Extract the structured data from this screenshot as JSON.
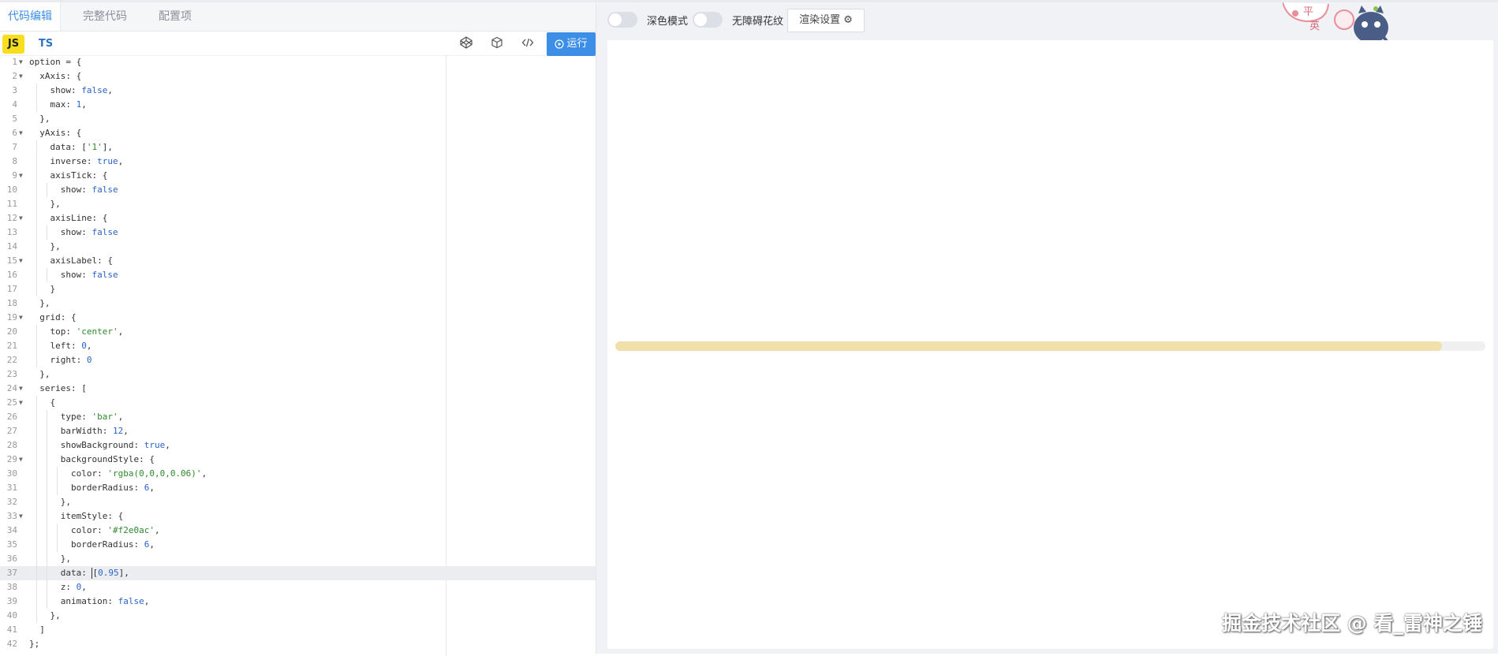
{
  "tabs": [
    {
      "label": "代码编辑",
      "active": true
    },
    {
      "label": "完整代码",
      "active": false
    },
    {
      "label": "配置项",
      "active": false
    }
  ],
  "toolbar": {
    "js_label": "JS",
    "ts_label": "TS",
    "run_label": "运行"
  },
  "preview": {
    "dark_mode_label": "深色模式",
    "accessibility_label": "无障碍花纹",
    "render_settings_label": "渲染设置 ⚙",
    "watermark": "掘金技术社区 @ 看_雷神之锤",
    "deco_text_1": "平",
    "deco_text_2": "英"
  },
  "editor": {
    "active_line": 37,
    "lines": [
      "option = {",
      "  xAxis: {",
      "    show: false,",
      "    max: 1,",
      "  },",
      "  yAxis: {",
      "    data: ['1'],",
      "    inverse: true,",
      "    axisTick: {",
      "      show: false",
      "    },",
      "    axisLine: {",
      "      show: false",
      "    },",
      "    axisLabel: {",
      "      show: false",
      "    }",
      "  },",
      "  grid: {",
      "    top: 'center',",
      "    left: 0,",
      "    right: 0",
      "  },",
      "  series: [",
      "    {",
      "      type: 'bar',",
      "      barWidth: 12,",
      "      showBackground: true,",
      "      backgroundStyle: {",
      "        color: 'rgba(0,0,0,0.06)',",
      "        borderRadius: 6,",
      "      },",
      "      itemStyle: {",
      "        color: '#f2e0ac',",
      "        borderRadius: 6,",
      "      },",
      "      data: [0.95],",
      "      z: 0,",
      "      animation: false,",
      "    },",
      "  ]",
      "};"
    ],
    "fold_lines": [
      1,
      2,
      6,
      9,
      12,
      15,
      19,
      24,
      25,
      29,
      33
    ]
  },
  "chart": {
    "value": 0.95,
    "max": 1,
    "bar_color": "#f2e0ac",
    "background_color": "rgba(0,0,0,0.06)"
  },
  "colors": {
    "accent": "#3d8ee6",
    "js_badge": "#f7df1e"
  }
}
